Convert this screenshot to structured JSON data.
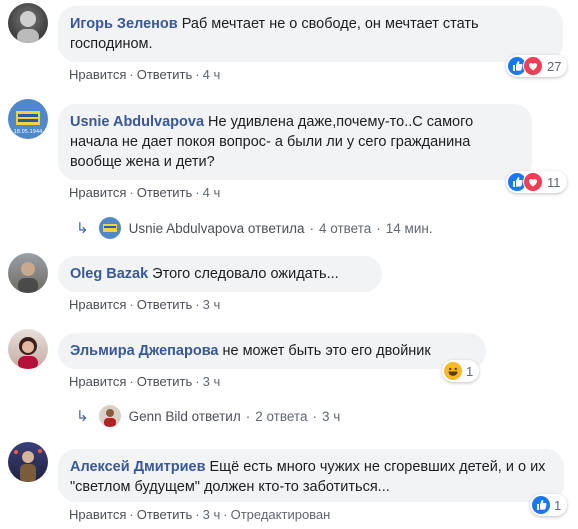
{
  "actions": {
    "like": "Нравится",
    "reply": "Ответить",
    "dot": "·"
  },
  "colors": {
    "link": "#385898",
    "like_blue": "#1877f2",
    "love_red": "#f33e58",
    "haha_yellow": "#f7b928"
  },
  "comments": [
    {
      "author": "Игорь Зеленов",
      "text": "Раб мечтает не о свободе, он мечтает стать господином.",
      "time": "4 ч",
      "reactions": [
        "like-icon",
        "love-icon"
      ],
      "reaction_count": "27"
    },
    {
      "author": "Usnie Abdulvapova",
      "text": "Не удивлена даже,почему-то..С самого начала не дает покоя вопрос- а были ли у сего гражданина вообще жена и дети?",
      "time": "4 ч",
      "reactions": [
        "like-icon",
        "love-icon"
      ],
      "reaction_count": "11",
      "reply_summary": {
        "name": "Usnie Abdulvapova ответила",
        "count": "4 ответа",
        "time": "14 мин."
      }
    },
    {
      "author": "Oleg Bazak",
      "text": "Этого следовало ожидать...",
      "time": "3 ч"
    },
    {
      "author": "Эльмира Джепарова",
      "text": "не может быть это его двойник",
      "time": "3 ч",
      "reactions": [
        "haha-icon"
      ],
      "reaction_count": "1",
      "reply_summary": {
        "name": "Genn Bild ответил",
        "count": "2 ответа",
        "time": "3 ч"
      }
    },
    {
      "author": "Алексей Дмитриев",
      "text": "Ещё есть много чужих не сгоревших детей, и о их \"светлом будущем\" должен кто-то заботиться...",
      "time": "3 ч",
      "edited": "Отредактирован",
      "reactions": [
        "like-icon"
      ],
      "reaction_count": "1"
    }
  ]
}
